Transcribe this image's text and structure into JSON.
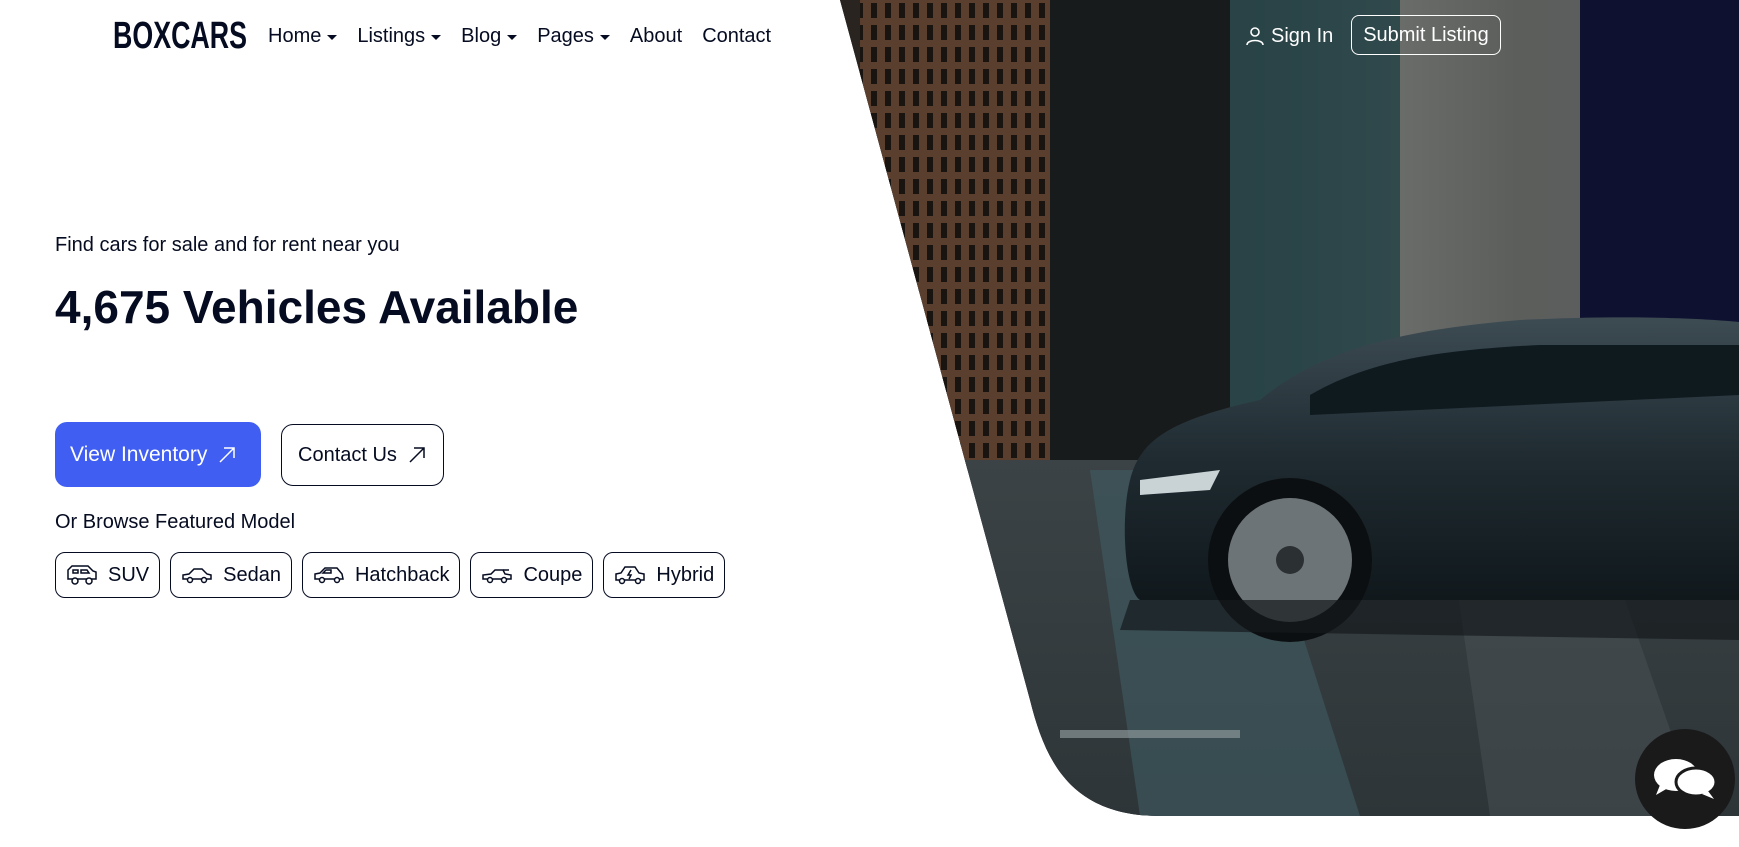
{
  "brand": {
    "logo_text": "BOXCARS"
  },
  "nav": {
    "items": [
      {
        "label": "Home",
        "dropdown": true
      },
      {
        "label": "Listings",
        "dropdown": true
      },
      {
        "label": "Blog",
        "dropdown": true
      },
      {
        "label": "Pages",
        "dropdown": true
      },
      {
        "label": "About",
        "dropdown": false
      },
      {
        "label": "Contact",
        "dropdown": false
      }
    ],
    "sign_in_label": "Sign In",
    "submit_listing_label": "Submit Listing"
  },
  "hero": {
    "subtitle": "Find cars for sale and for rent near you",
    "headline": "4,675 Vehicles Available",
    "primary_button_label": "View Inventory",
    "secondary_button_label": "Contact Us",
    "browse_label": "Or Browse Featured Model",
    "models": [
      {
        "label": "SUV",
        "icon": "suv-icon"
      },
      {
        "label": "Sedan",
        "icon": "sedan-icon"
      },
      {
        "label": "Hatchback",
        "icon": "hatchback-icon"
      },
      {
        "label": "Coupe",
        "icon": "coupe-icon"
      },
      {
        "label": "Hybrid",
        "icon": "hybrid-icon"
      }
    ]
  },
  "colors": {
    "primary": "#405ff2",
    "text": "#050b20",
    "background": "#ffffff"
  },
  "chat": {
    "icon": "chat-bubbles-icon"
  }
}
